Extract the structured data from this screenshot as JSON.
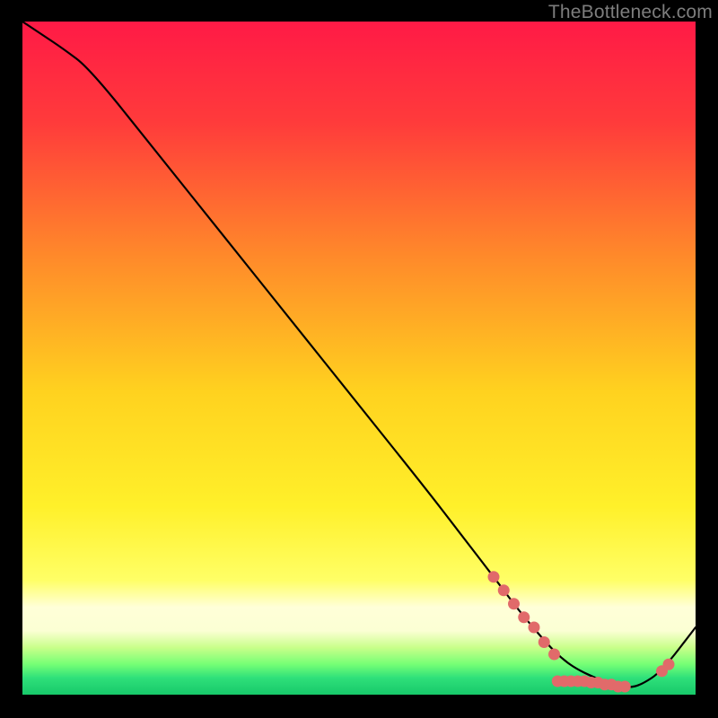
{
  "watermark": "TheBottleneck.com",
  "chart_data": {
    "type": "line",
    "title": "",
    "xlabel": "",
    "ylabel": "",
    "xlim": [
      0,
      100
    ],
    "ylim": [
      0,
      100
    ],
    "series": [
      {
        "name": "bottleneck-curve",
        "x": [
          0,
          3,
          6,
          10,
          20,
          30,
          40,
          50,
          60,
          65,
          70,
          73,
          75,
          78,
          80,
          82,
          85,
          88,
          90,
          92,
          95,
          100
        ],
        "y": [
          100,
          98,
          96,
          93,
          80.5,
          68,
          55.5,
          43,
          30.5,
          24,
          17.5,
          13.5,
          11,
          7.5,
          5.5,
          4,
          2.5,
          1.5,
          1,
          1.5,
          3.5,
          10
        ],
        "color": "#000000"
      }
    ],
    "markers": {
      "name": "highlight-points",
      "color": "#e16a6a",
      "points": [
        {
          "x": 70,
          "y": 17.5
        },
        {
          "x": 71.5,
          "y": 15.5
        },
        {
          "x": 73,
          "y": 13.5
        },
        {
          "x": 74.5,
          "y": 11.5
        },
        {
          "x": 76,
          "y": 10
        },
        {
          "x": 77.5,
          "y": 7.8
        },
        {
          "x": 79,
          "y": 6
        },
        {
          "x": 79.5,
          "y": 2
        },
        {
          "x": 80.5,
          "y": 2
        },
        {
          "x": 81.5,
          "y": 2
        },
        {
          "x": 82.5,
          "y": 2
        },
        {
          "x": 83.5,
          "y": 2
        },
        {
          "x": 84.5,
          "y": 1.8
        },
        {
          "x": 85.5,
          "y": 1.8
        },
        {
          "x": 86.5,
          "y": 1.5
        },
        {
          "x": 87.5,
          "y": 1.5
        },
        {
          "x": 88.5,
          "y": 1.2
        },
        {
          "x": 89.5,
          "y": 1.2
        },
        {
          "x": 95,
          "y": 3.5
        },
        {
          "x": 96,
          "y": 4.5
        }
      ]
    },
    "gradient_bands": {
      "description": "vertical rainbow gradient from red (top) through orange, yellow to green (bottom), with a bright near-white yellow band around y≈13, on black background",
      "stops": [
        {
          "offset": 0,
          "color": "#ff1a46"
        },
        {
          "offset": 0.15,
          "color": "#ff3b3b"
        },
        {
          "offset": 0.35,
          "color": "#ff8a2a"
        },
        {
          "offset": 0.55,
          "color": "#ffd21f"
        },
        {
          "offset": 0.72,
          "color": "#fff02a"
        },
        {
          "offset": 0.83,
          "color": "#ffff66"
        },
        {
          "offset": 0.87,
          "color": "#ffffd8"
        },
        {
          "offset": 0.905,
          "color": "#fbffd4"
        },
        {
          "offset": 0.93,
          "color": "#c9ff8a"
        },
        {
          "offset": 0.955,
          "color": "#75ff75"
        },
        {
          "offset": 0.975,
          "color": "#2fe07a"
        },
        {
          "offset": 1.0,
          "color": "#17c96a"
        }
      ]
    }
  }
}
